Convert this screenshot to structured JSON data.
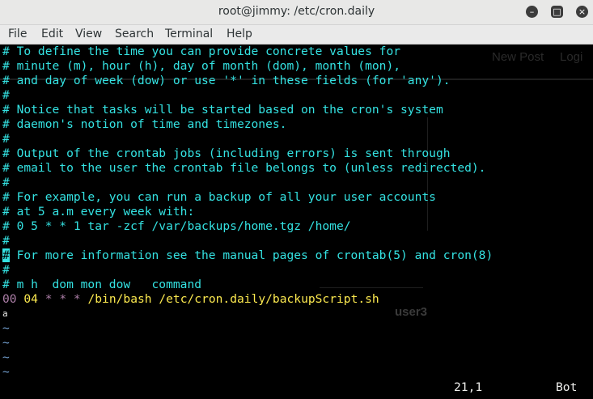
{
  "window": {
    "title": "root@jimmy: /etc/cron.daily",
    "minimize_icon": "minimize-icon",
    "maximize_icon": "maximize-icon",
    "close_icon": "close-icon"
  },
  "menu": [
    "File",
    "Edit",
    "View",
    "Search",
    "Terminal",
    "Help"
  ],
  "background_ghost": {
    "new_post": "New Post",
    "login": "Logi",
    "user": "user3"
  },
  "lines": [
    "# To define the time you can provide concrete values for",
    "# minute (m), hour (h), day of month (dom), month (mon),",
    "# and day of week (dow) or use '*' in these fields (for 'any').",
    "#",
    "# Notice that tasks will be started based on the cron's system",
    "# daemon's notion of time and timezones.",
    "#",
    "# Output of the crontab jobs (including errors) is sent through",
    "# email to the user the crontab file belongs to (unless redirected).",
    "#",
    "# For example, you can run a backup of all your user accounts",
    "# at 5 a.m every week with:",
    "# 0 5 * * 1 tar -zcf /var/backups/home.tgz /home/",
    "#",
    " For more information see the manual pages of crontab(5) and cron(8)",
    "#",
    "# m h  dom mon dow   command"
  ],
  "cursor_char": "#",
  "cron_line": {
    "minute": "00",
    "hour": "04",
    "stars": "* * *",
    "command": "/bin/bash /etc/cron.daily/backupScript.sh"
  },
  "empty_line_marker": "~",
  "status": {
    "position": "21,1",
    "scroll": "Bot"
  },
  "colors": {
    "comment": "#34e2e2",
    "minute": "#ad7fa8",
    "hour": "#fce94f",
    "tilde": "#729fcf"
  }
}
